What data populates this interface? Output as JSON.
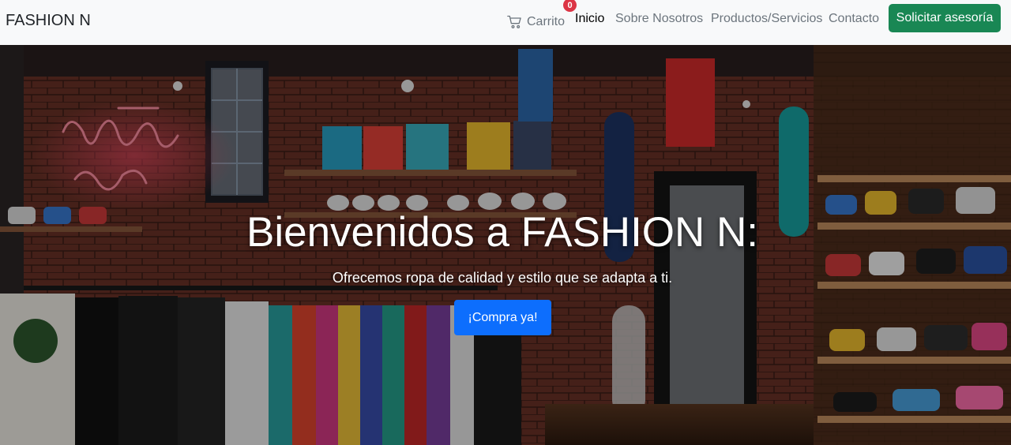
{
  "navbar": {
    "brand": "FASHION N",
    "cart": {
      "label": "Carrito",
      "count": "0",
      "icon": "cart-icon"
    },
    "links": [
      {
        "label": "Inicio",
        "active": true
      },
      {
        "label": "Sobre Nosotros",
        "active": false
      },
      {
        "label": "Productos/Servicios",
        "active": false
      },
      {
        "label": "Contacto",
        "active": false
      }
    ],
    "cta": "Solicitar asesoría"
  },
  "hero": {
    "title": "Bienvenidos a FASHION N:",
    "subtitle": "Ofrecemos ropa de calidad y estilo que se adapta a ti.",
    "button": "¡Compra ya!"
  },
  "colors": {
    "navbar_bg": "#f8f9fa",
    "cta": "#198754",
    "primary": "#0d6efd",
    "badge": "#dc3545"
  }
}
